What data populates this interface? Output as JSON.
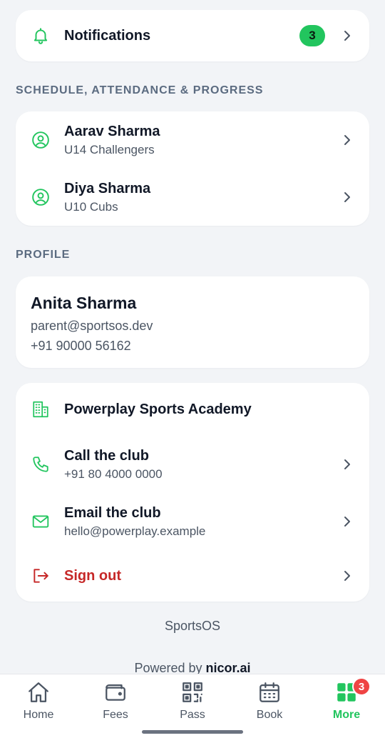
{
  "notifications": {
    "label": "Notifications",
    "count": "3"
  },
  "schedule_section": {
    "heading": "SCHEDULE, ATTENDANCE & PROGRESS",
    "children": [
      {
        "name": "Aarav Sharma",
        "team": "U14 Challengers"
      },
      {
        "name": "Diya Sharma",
        "team": "U10 Cubs"
      }
    ]
  },
  "profile_section": {
    "heading": "PROFILE",
    "name": "Anita Sharma",
    "email": "parent@sportsos.dev",
    "phone": "+91 90000 56162"
  },
  "club": {
    "name": "Powerplay Sports Academy",
    "call_label": "Call the club",
    "call_value": "+91 80 4000 0000",
    "email_label": "Email the club",
    "email_value": "hello@powerplay.example",
    "signout_label": "Sign out"
  },
  "footer": {
    "brand": "SportsOS",
    "powered_prefix": "Powered by",
    "powered_brand": "nicor.ai"
  },
  "tabbar": {
    "tabs": [
      {
        "label": "Home",
        "icon": "home-icon"
      },
      {
        "label": "Fees",
        "icon": "wallet-icon"
      },
      {
        "label": "Pass",
        "icon": "qr-code-icon"
      },
      {
        "label": "Book",
        "icon": "calendar-icon"
      },
      {
        "label": "More",
        "icon": "grid-icon",
        "badge": "3",
        "active": true
      }
    ]
  },
  "colors": {
    "accent": "#22c55e",
    "danger": "#c62828",
    "badge_red": "#ef4444",
    "background": "#f2f4f7",
    "section_label": "#5b6b80"
  }
}
